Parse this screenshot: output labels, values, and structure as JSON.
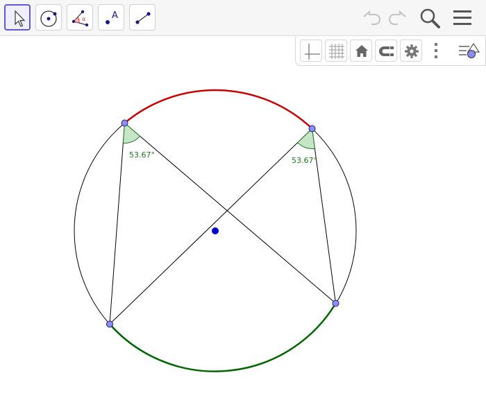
{
  "toolbar": {
    "tools": [
      {
        "name": "Move",
        "icon": "cursor-arrow-icon",
        "selected": true
      },
      {
        "name": "Circle with Center through Point",
        "icon": "circle-center-point-icon"
      },
      {
        "name": "Angle",
        "icon": "angle-icon"
      },
      {
        "name": "Text",
        "icon": "text-point-icon"
      },
      {
        "name": "Segment",
        "icon": "segment-icon"
      }
    ],
    "right_icons": [
      "undo-icon",
      "redo-icon",
      "search-icon",
      "menu-icon"
    ]
  },
  "style_bar": {
    "buttons": [
      "axes-icon",
      "grid-icon",
      "home-icon",
      "magnet-icon",
      "gear-icon",
      "more-vertical-icon",
      "style-bar-toggle-icon"
    ]
  },
  "construction": {
    "angle_labels": {
      "left": "53.67°",
      "right": "53.67°"
    },
    "colors": {
      "major_arc": "#cc0000",
      "minor_arc": "#006600",
      "point_fill": "#8a8ff0",
      "point_stroke": "#1a1a8a",
      "center_fill": "#0000cc",
      "angle_fill": "#c6e4c6",
      "angle_stroke": "#1a7a1a",
      "lines": "#000000"
    }
  }
}
